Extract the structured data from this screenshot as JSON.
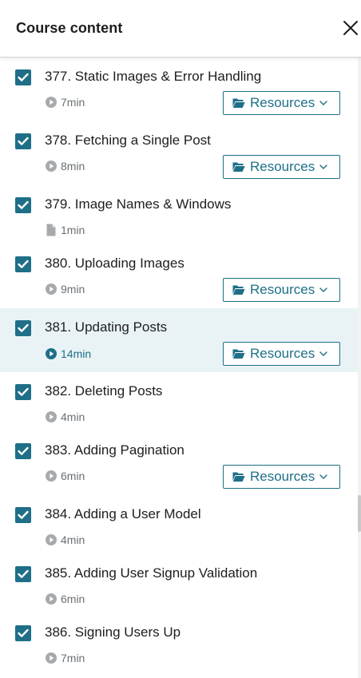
{
  "header": {
    "title": "Course content"
  },
  "resources_label": "Resources",
  "items": [
    {
      "title": "377. Static Images & Error Handling",
      "duration": "7min",
      "type": "video",
      "has_resources": true,
      "checked": true,
      "active": false
    },
    {
      "title": "378. Fetching a Single Post",
      "duration": "8min",
      "type": "video",
      "has_resources": true,
      "checked": true,
      "active": false
    },
    {
      "title": "379. Image Names & Windows",
      "duration": "1min",
      "type": "article",
      "has_resources": false,
      "checked": true,
      "active": false
    },
    {
      "title": "380. Uploading Images",
      "duration": "9min",
      "type": "video",
      "has_resources": true,
      "checked": true,
      "active": false
    },
    {
      "title": "381. Updating Posts",
      "duration": "14min",
      "type": "video",
      "has_resources": true,
      "checked": true,
      "active": true
    },
    {
      "title": "382. Deleting Posts",
      "duration": "4min",
      "type": "video",
      "has_resources": false,
      "checked": true,
      "active": false
    },
    {
      "title": "383. Adding Pagination",
      "duration": "6min",
      "type": "video",
      "has_resources": true,
      "checked": true,
      "active": false
    },
    {
      "title": "384. Adding a User Model",
      "duration": "4min",
      "type": "video",
      "has_resources": false,
      "checked": true,
      "active": false
    },
    {
      "title": "385. Adding User Signup Validation",
      "duration": "6min",
      "type": "video",
      "has_resources": false,
      "checked": true,
      "active": false
    },
    {
      "title": "386. Signing Users Up",
      "duration": "7min",
      "type": "video",
      "has_resources": false,
      "checked": true,
      "active": false
    }
  ],
  "colors": {
    "accent": "#1e6f87",
    "active_bg": "#e9f3f6",
    "muted": "#6a6f73",
    "text": "#1c1d1f"
  },
  "icons": {
    "close": "close-icon",
    "checkbox": "check-icon",
    "video": "play-circle-icon",
    "article": "file-icon",
    "resources": "folder-open-icon",
    "dropdown": "chevron-down-icon"
  }
}
